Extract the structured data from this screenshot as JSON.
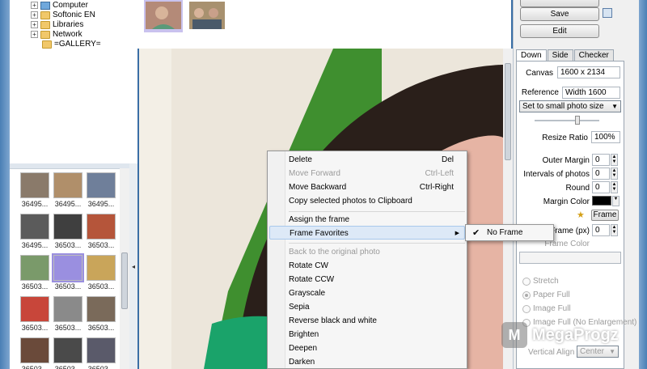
{
  "tree": {
    "items": [
      {
        "label": "Computer",
        "icon": "computer-icon"
      },
      {
        "label": "Softonic EN",
        "icon": "folder-icon"
      },
      {
        "label": "Libraries",
        "icon": "folder-icon"
      },
      {
        "label": "Network",
        "icon": "folder-icon"
      },
      {
        "label": "=GALLERY=",
        "icon": "folder-icon"
      }
    ]
  },
  "thumbnails": [
    {
      "label": "36495...",
      "color": "#8a7a6a"
    },
    {
      "label": "36495...",
      "color": "#b08f6a"
    },
    {
      "label": "36495...",
      "color": "#6f7f9a"
    },
    {
      "label": "36495...",
      "color": "#5b5b5b"
    },
    {
      "label": "36503...",
      "color": "#3f3f3f"
    },
    {
      "label": "36503...",
      "color": "#b5553a"
    },
    {
      "label": "36503...",
      "color": "#7a9a6a"
    },
    {
      "label": "36503...",
      "color": "#9a8fe0"
    },
    {
      "label": "36503...",
      "color": "#c9a55a"
    },
    {
      "label": "36503...",
      "color": "#c8463a"
    },
    {
      "label": "36503...",
      "color": "#8a8a8a"
    },
    {
      "label": "36503...",
      "color": "#7a6a5a"
    },
    {
      "label": "36503...",
      "color": "#6a4a3a"
    },
    {
      "label": "36503...",
      "color": "#4a4a4a"
    },
    {
      "label": "36503...",
      "color": "#5a5a6a"
    }
  ],
  "strip": [
    {
      "color": "#b48a78"
    },
    {
      "color": "#a8916f"
    }
  ],
  "right_panel": {
    "buttons": {
      "save": "Save",
      "edit": "Edit"
    },
    "tabs": [
      "Down",
      "Side",
      "Checker"
    ],
    "active_tab": "Down",
    "canvas_label": "Canvas",
    "canvas_value": "1600 x 2134",
    "reference_label": "Reference",
    "reference_value": "Width 1600",
    "size_select": "Set to small photo size",
    "resize_label": "Resize Ratio",
    "resize_value": "100%",
    "outer_margin_label": "Outer Margin",
    "outer_margin_value": "0",
    "intervals_label": "Intervals of photos",
    "intervals_value": "0",
    "round_label": "Round",
    "round_value": "0",
    "margin_color_label": "Margin Color",
    "margin_color": "#000000",
    "frame_btn": "Frame",
    "frame_px_label": "Frame (px)",
    "frame_px_value": "0",
    "frame_color_label": "Frame Color",
    "radios": [
      "Stretch",
      "Paper Full",
      "Image Full",
      "Image Full (No Enlargement)"
    ],
    "radio_selected": "Paper Full",
    "vertical_align_label": "Vertical Align",
    "vertical_align_value": "Center"
  },
  "context_menu": {
    "items": [
      {
        "label": "Delete",
        "shortcut": "Del",
        "disabled": false
      },
      {
        "label": "Move Forward",
        "shortcut": "Ctrl-Left",
        "disabled": true
      },
      {
        "label": "Move Backward",
        "shortcut": "Ctrl-Right",
        "disabled": false
      },
      {
        "label": "Copy selected photos to Clipboard",
        "shortcut": "",
        "disabled": false
      },
      {
        "label": "Assign the frame",
        "shortcut": "",
        "disabled": false
      },
      {
        "label": "Frame Favorites",
        "shortcut": "",
        "disabled": false,
        "submenu": true
      },
      {
        "label": "Back to the original photo",
        "shortcut": "",
        "disabled": true
      },
      {
        "label": "Rotate CW",
        "shortcut": "",
        "disabled": false
      },
      {
        "label": "Rotate CCW",
        "shortcut": "",
        "disabled": false
      },
      {
        "label": "Grayscale",
        "shortcut": "",
        "disabled": false
      },
      {
        "label": "Sepia",
        "shortcut": "",
        "disabled": false
      },
      {
        "label": "Reverse black and white",
        "shortcut": "",
        "disabled": false
      },
      {
        "label": "Brighten",
        "shortcut": "",
        "disabled": false
      },
      {
        "label": "Deepen",
        "shortcut": "",
        "disabled": false
      },
      {
        "label": "Darken",
        "shortcut": "",
        "disabled": false
      }
    ],
    "submenu": {
      "label": "No Frame",
      "checked": true
    }
  },
  "watermark": {
    "text": "MegaProgz",
    "logo": "M"
  }
}
